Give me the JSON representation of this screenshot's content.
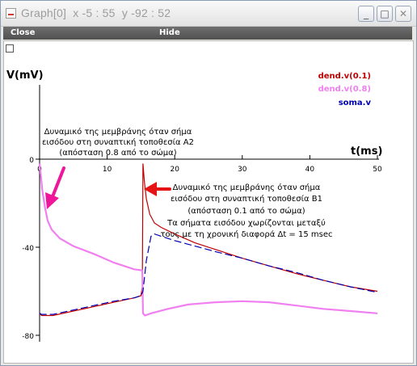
{
  "window": {
    "title": "Graph[0]  x -5 : 55  y -92 : 52",
    "buttons": {
      "minimize": "_",
      "maximize": "□",
      "close": "✕"
    }
  },
  "menubar": {
    "close_label": "Close",
    "hide_label": "Hide"
  },
  "icons": {
    "app": "graph-window-icon",
    "checkbox": "checkbox-icon",
    "arrow_pink": "pink-arrow-icon",
    "arrow_red": "red-arrow-icon"
  },
  "colors": {
    "dend_0_1": "#c00000",
    "dend_0_8": "#f080f0",
    "soma": "#0000b0",
    "axis": "#000000"
  },
  "chart_data": {
    "type": "line",
    "xlabel": "t(ms)",
    "ylabel": "V(mV)",
    "xlim": [
      0,
      50
    ],
    "ylim": [
      -80,
      0
    ],
    "x_ticks": [
      0,
      10,
      20,
      30,
      40,
      50
    ],
    "y_ticks": [
      0,
      -40,
      -80
    ],
    "legend_position": "top-right",
    "series": [
      {
        "name": "dend.v(0.1)",
        "color": "#c00000",
        "points": [
          [
            0,
            -70
          ],
          [
            0.3,
            -71
          ],
          [
            2,
            -71
          ],
          [
            5,
            -69
          ],
          [
            8,
            -67
          ],
          [
            11,
            -65
          ],
          [
            14,
            -63
          ],
          [
            15,
            -62
          ],
          [
            15.2,
            -58
          ],
          [
            15.3,
            -2
          ],
          [
            15.5,
            -10
          ],
          [
            15.8,
            -18
          ],
          [
            16.3,
            -25
          ],
          [
            17,
            -29
          ],
          [
            18,
            -31
          ],
          [
            20,
            -34
          ],
          [
            23,
            -38
          ],
          [
            26,
            -41
          ],
          [
            30,
            -45
          ],
          [
            34,
            -48.5
          ],
          [
            38,
            -52
          ],
          [
            42,
            -55
          ],
          [
            46,
            -58
          ],
          [
            50,
            -60
          ]
        ]
      },
      {
        "name": "dend.v(0.8)",
        "color": "#f080f0",
        "points": [
          [
            0,
            -2
          ],
          [
            0.2,
            -8
          ],
          [
            0.4,
            -14
          ],
          [
            0.8,
            -22
          ],
          [
            1.2,
            -28
          ],
          [
            1.8,
            -32
          ],
          [
            3,
            -36
          ],
          [
            5,
            -39.5
          ],
          [
            8,
            -43
          ],
          [
            11,
            -47
          ],
          [
            14,
            -50
          ],
          [
            15.2,
            -50.5
          ],
          [
            15.3,
            -70
          ],
          [
            15.6,
            -71
          ],
          [
            16.5,
            -70
          ],
          [
            19,
            -68
          ],
          [
            22,
            -66
          ],
          [
            26,
            -65
          ],
          [
            30,
            -64.5
          ],
          [
            34,
            -65
          ],
          [
            38,
            -66.5
          ],
          [
            42,
            -68
          ],
          [
            46,
            -69
          ],
          [
            50,
            -70
          ]
        ]
      },
      {
        "name": "soma.v",
        "color": "#0000b0",
        "points": [
          [
            0,
            -70
          ],
          [
            0.3,
            -70.5
          ],
          [
            2,
            -70.5
          ],
          [
            5,
            -68.5
          ],
          [
            8,
            -66.5
          ],
          [
            11,
            -64.5
          ],
          [
            14,
            -63
          ],
          [
            15,
            -62
          ],
          [
            15.3,
            -60
          ],
          [
            15.8,
            -46
          ],
          [
            16.5,
            -35
          ],
          [
            17,
            -34
          ],
          [
            18,
            -35
          ],
          [
            20,
            -37
          ],
          [
            23,
            -39.5
          ],
          [
            26,
            -42
          ],
          [
            30,
            -45
          ],
          [
            34,
            -48.5
          ],
          [
            38,
            -51.5
          ],
          [
            42,
            -55
          ],
          [
            46,
            -58
          ],
          [
            50,
            -60.5
          ]
        ]
      }
    ],
    "annotations": [
      {
        "id": "pink",
        "lines": [
          "Δυναμικό της μεμβράνης όταν σήμα",
          "εισόδου στη συναπτική τοποθεσία Α2",
          "(απόσταση 0.8 από το σώμα)"
        ]
      },
      {
        "id": "red",
        "lines": [
          "Δυναμικό της μεμβράνης όταν σήμα",
          "εισόδου στη συναπτική τοποθεσία Β1",
          "(απόσταση 0.1 από το σώμα)",
          "Τα σήματα εισόδου χωρίζονται μεταξύ",
          "τους με τη χρονική διαφορά Δt = 15 msec"
        ]
      }
    ]
  }
}
